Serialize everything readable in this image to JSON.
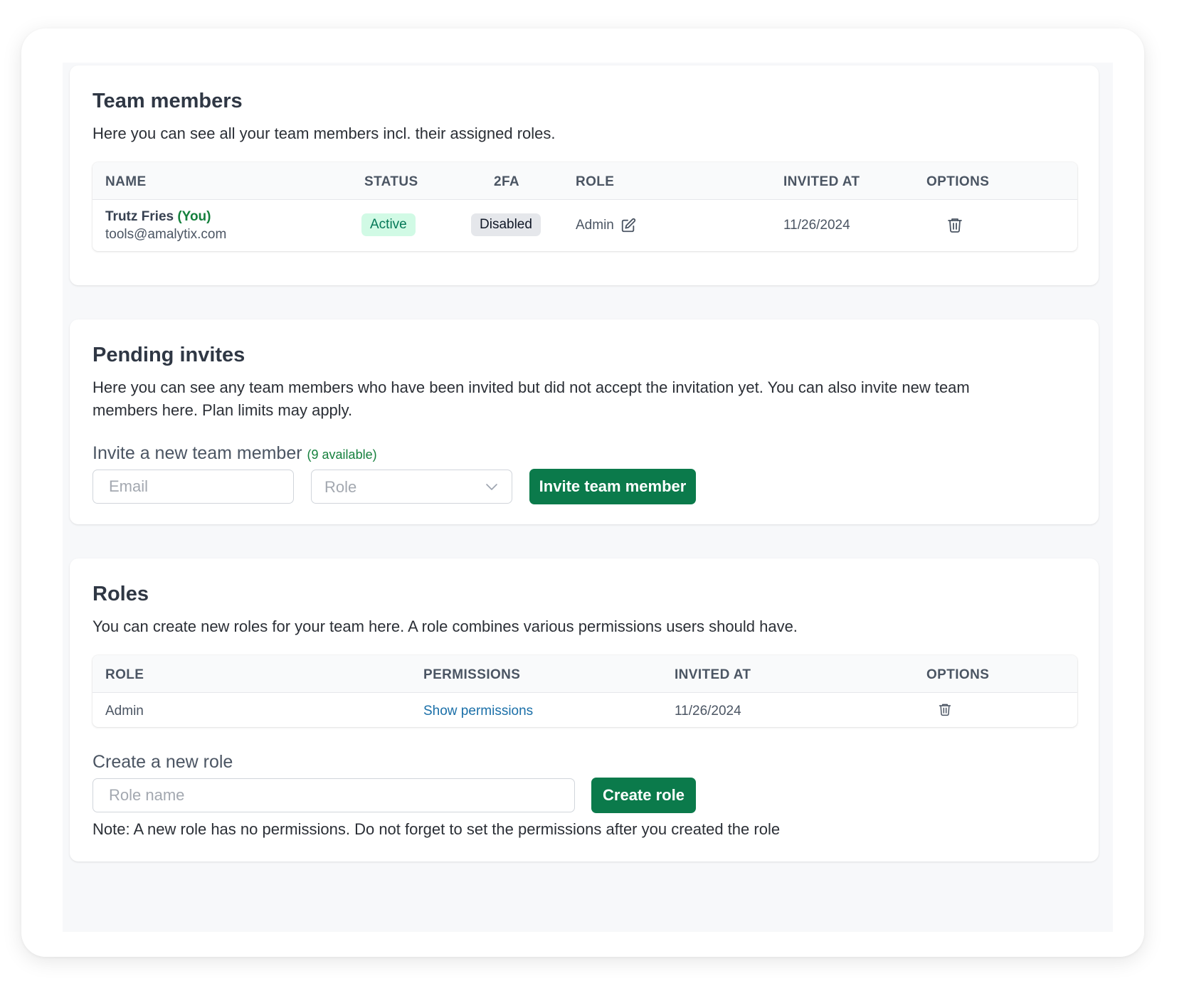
{
  "team_members": {
    "title": "Team members",
    "description": "Here you can see all your team members incl. their assigned roles.",
    "columns": {
      "name": "NAME",
      "status": "STATUS",
      "twofa": "2FA",
      "role": "ROLE",
      "invited_at": "INVITED AT",
      "options": "OPTIONS"
    },
    "rows": [
      {
        "name": "Trutz Fries",
        "you_tag": "(You)",
        "email": "tools@amalytix.com",
        "status": "Active",
        "twofa": "Disabled",
        "role": "Admin",
        "invited_at": "11/26/2024"
      }
    ]
  },
  "pending_invites": {
    "title": "Pending invites",
    "description": "Here you can see any team members who have been invited but did not accept the invitation yet. You can also invite new team members here. Plan limits may apply.",
    "invite_label": "Invite a new team member",
    "available": "(9 available)",
    "email_placeholder": "Email",
    "role_placeholder": "Role",
    "invite_button": "Invite team member"
  },
  "roles": {
    "title": "Roles",
    "description": "You can create new roles for your team here. A role combines various permissions users should have.",
    "columns": {
      "role": "ROLE",
      "permissions": "PERMISSIONS",
      "invited_at": "INVITED AT",
      "options": "OPTIONS"
    },
    "rows": [
      {
        "role": "Admin",
        "permissions_link": "Show permissions",
        "invited_at": "11/26/2024"
      }
    ],
    "create_label": "Create a new role",
    "role_name_placeholder": "Role name",
    "create_button": "Create role",
    "note": "Note: A new role has no permissions. Do not forget to set the permissions after you created the role"
  },
  "colors": {
    "accent": "#0b7a4b",
    "status_active_bg": "#d1fae5",
    "status_active_text": "#047857",
    "link": "#1a6fa8"
  },
  "icons": [
    "edit-icon",
    "trash-icon",
    "chevron-down-icon"
  ]
}
